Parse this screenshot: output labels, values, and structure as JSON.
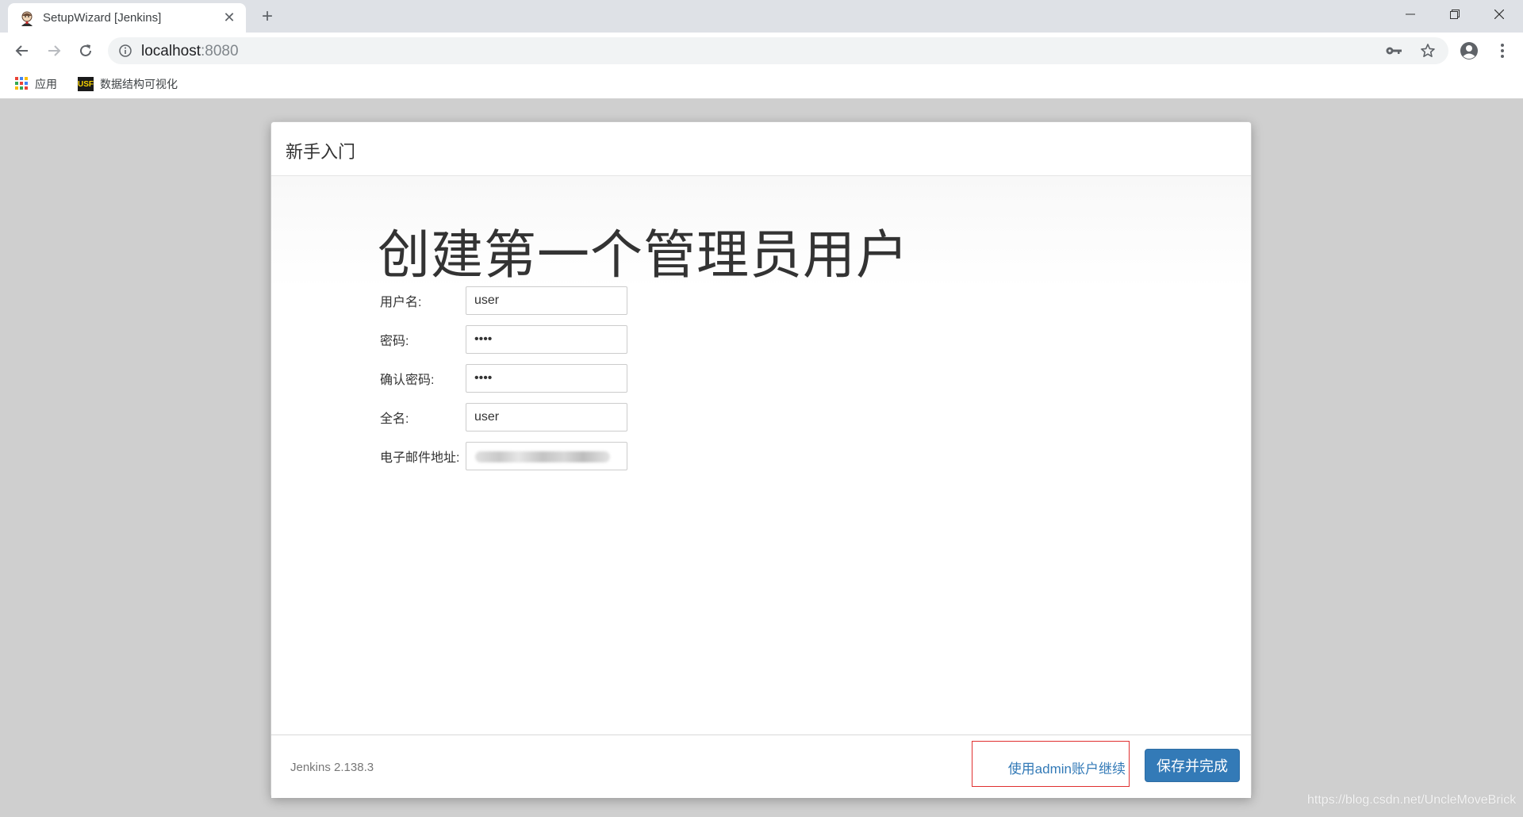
{
  "browser": {
    "tab": {
      "title": "SetupWizard [Jenkins]",
      "close_glyph": "✕",
      "favicon": "jenkins-butler-icon"
    },
    "new_tab_glyph": "+",
    "address": {
      "host": "localhost",
      "port": ":8080"
    },
    "bookmarks": [
      {
        "label": "应用",
        "icon": "apps-grid-icon"
      },
      {
        "label": "数据结构可视化",
        "icon": "usf-logo-icon",
        "logo_text": "USF"
      }
    ]
  },
  "dialog": {
    "header_title": "新手入门",
    "page_title": "创建第一个管理员用户",
    "form": {
      "username": {
        "label": "用户名:",
        "value": "user"
      },
      "password": {
        "label": "密码:",
        "value": "••••"
      },
      "confirm_password": {
        "label": "确认密码:",
        "value": "••••"
      },
      "fullname": {
        "label": "全名:",
        "value": "user"
      },
      "email": {
        "label": "电子邮件地址:"
      }
    },
    "footer": {
      "version": "Jenkins 2.138.3",
      "admin_link": "使用admin账户继续",
      "save_button": "保存并完成"
    }
  },
  "watermark": "https://blog.csdn.net/UncleMoveBrick",
  "colors": {
    "primary_button": "#337ab7",
    "link": "#337ab7",
    "highlight_border": "#e03030",
    "page_background": "#cfcfcf"
  }
}
